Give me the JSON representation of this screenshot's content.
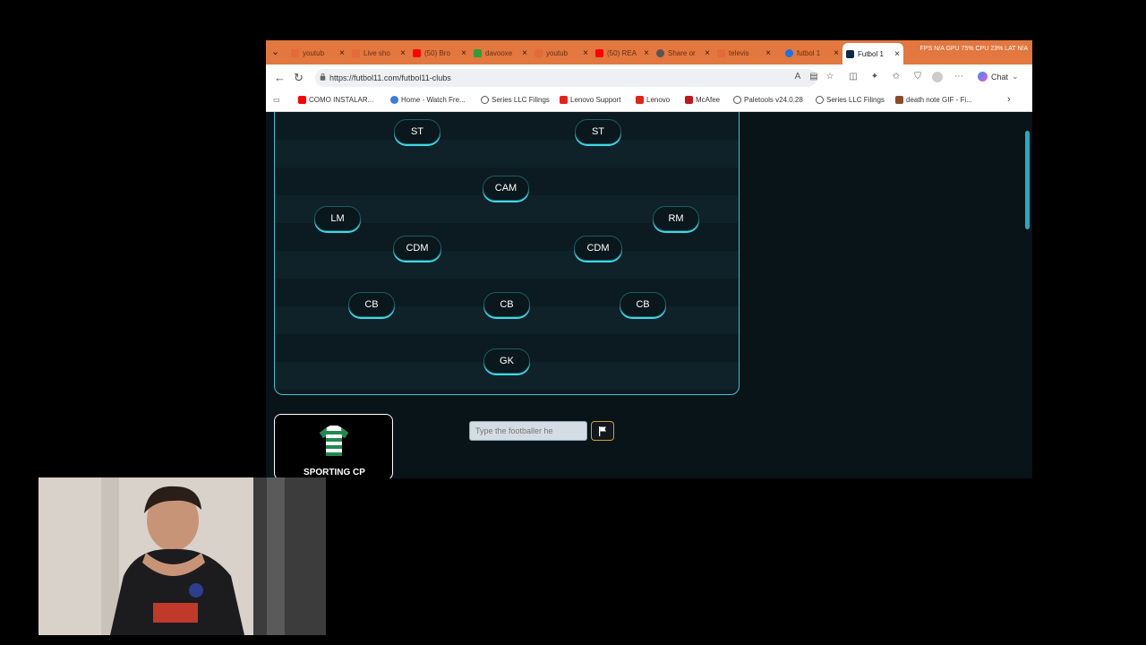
{
  "browser": {
    "tabs": [
      {
        "label": "youtub",
        "favicon_color": "#e36a3a"
      },
      {
        "label": "Live sho",
        "favicon_color": "#e36a3a"
      },
      {
        "label": "(50) Bro",
        "favicon_color": "#ff0000"
      },
      {
        "label": "davooxe",
        "favicon_color": "#2e9d3a"
      },
      {
        "label": "youtub",
        "favicon_color": "#e36a3a"
      },
      {
        "label": "(50) REA",
        "favicon_color": "#ff0000"
      },
      {
        "label": "Share or",
        "favicon_color": "#555555"
      },
      {
        "label": "televis",
        "favicon_color": "#e36a3a"
      },
      {
        "label": "futbol 1",
        "favicon_color": "#1a73e8"
      },
      {
        "label": "Futbol 1",
        "favicon_color": "#0b2a4a"
      }
    ],
    "sys_stats": "FPS N/A  GPU 75%  CPU 23%  LAT N/A",
    "url": "https://futbol11.com/futbol11-clubs",
    "chat_label": "Chat",
    "bookmarks": [
      {
        "label": "COMO INSTALAR...",
        "color": "#ff0000"
      },
      {
        "label": "Home - Watch Fre...",
        "color": "#3b7be0"
      },
      {
        "label": "Series LLC Filings",
        "color": "#555555"
      },
      {
        "label": "Lenovo Support",
        "color": "#e2231a"
      },
      {
        "label": "Lenovo",
        "color": "#e2231a"
      },
      {
        "label": "McAfee",
        "color": "#c01818"
      },
      {
        "label": "Paletools v24.0.28",
        "color": "#555555"
      },
      {
        "label": "Series LLC Filings",
        "color": "#555555"
      },
      {
        "label": "death note GIF - Fi...",
        "color": "#8a4b2a"
      }
    ]
  },
  "formation": {
    "st_left": "ST",
    "st_right": "ST",
    "cam": "CAM",
    "lm": "LM",
    "rm": "RM",
    "cdm_left": "CDM",
    "cdm_right": "CDM",
    "cb_left": "CB",
    "cb_center": "CB",
    "cb_right": "CB",
    "gk": "GK"
  },
  "club": {
    "name": "SPORTING CP",
    "jersey_colors": [
      "#1f8a4c",
      "#ffffff"
    ]
  },
  "search": {
    "placeholder": "Type the footballer he"
  },
  "colors": {
    "accent": "#3fd8e6",
    "pitch_border": "#3fc3d0",
    "background": "#091418",
    "tabbar": "#e2773f"
  }
}
